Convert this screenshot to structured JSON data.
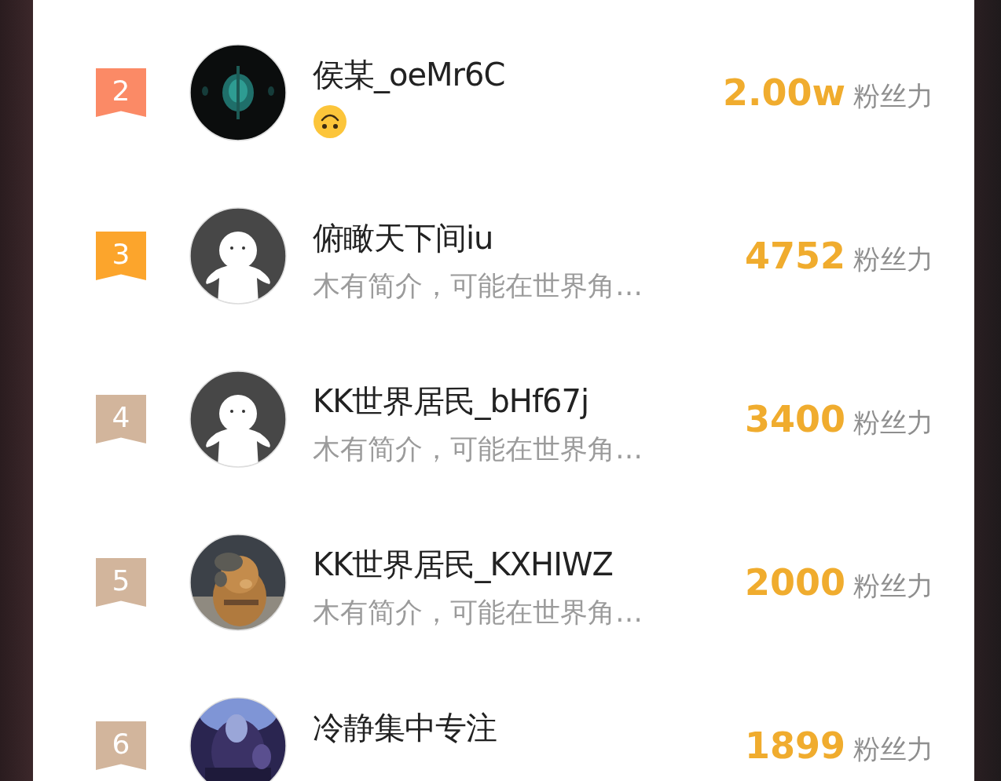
{
  "rows": [
    {
      "rank": "2",
      "color": "#fb8a66",
      "kind": "picture",
      "name": "侯某_oeMr6C",
      "emoji": true,
      "score": "2.00w",
      "score_label": "粉丝力"
    },
    {
      "rank": "3",
      "color": "#fca52c",
      "kind": "default",
      "name": "俯瞰天下间iu",
      "bio": "木有简介，可能在世界角…",
      "score": "4752",
      "score_label": "粉丝力"
    },
    {
      "rank": "4",
      "color": "#d2b59c",
      "kind": "default",
      "name": "KK世界居民_bHf67j",
      "bio": "木有简介，可能在世界角…",
      "score": "3400",
      "score_label": "粉丝力"
    },
    {
      "rank": "5",
      "color": "#d2b59c",
      "kind": "picture",
      "name": "KK世界居民_KXHIWZ",
      "bio": "木有简介，可能在世界角…",
      "score": "2000",
      "score_label": "粉丝力"
    },
    {
      "rank": "6",
      "color": "#d2b59c",
      "kind": "picture",
      "name": "冷静集中专注",
      "score": "1899",
      "score_label": "粉丝力"
    }
  ]
}
